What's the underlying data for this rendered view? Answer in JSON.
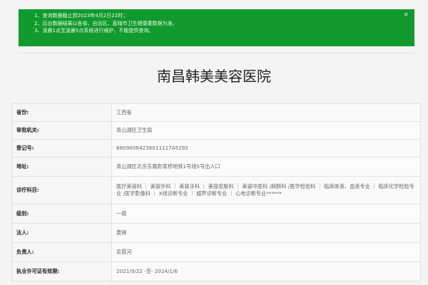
{
  "notice": {
    "lines": [
      "1、查询数据截止到2023年4月2日22时；",
      "2、后台数据结果以各省、自治区、直辖市卫生健康委数据为准。",
      "3、凌晨1点至凌晨5点系统进行维护，不能提供查询。"
    ],
    "close_label": "×"
  },
  "hospital": {
    "title": "南昌韩美美容医院"
  },
  "info_rows": [
    {
      "label": "省份:",
      "value": "江西省"
    },
    {
      "label": "审批机关:",
      "value": "青山湖区卫生局"
    },
    {
      "label": "登记号:",
      "value": "68090064236011117A5292"
    },
    {
      "label": "地址:",
      "value": "青山湖区北京东路影家桥地铁1号线5号出入口"
    },
    {
      "label": "诊疗科目:",
      "value": "医疗美容科 ｜ 美容外科 ｜ 美容牙科 ｜ 美容皮肤科 ｜ 美容中医科 /麻醉科 /医学检验科 ｜ 临床体液、血液专业 ｜ 临床化学检验专业 /医学影像科 ｜ X线诊断专业 ｜ 超声诊断专业 ｜ 心电诊断专业******"
    },
    {
      "label": "级别:",
      "value": "一级"
    },
    {
      "label": "法人:",
      "value": "黄锋"
    },
    {
      "label": "负责人:",
      "value": "俞晨河"
    },
    {
      "label": "执业许可证有效期:",
      "value": "2021/9/22 -至- 2024/1/6"
    }
  ]
}
